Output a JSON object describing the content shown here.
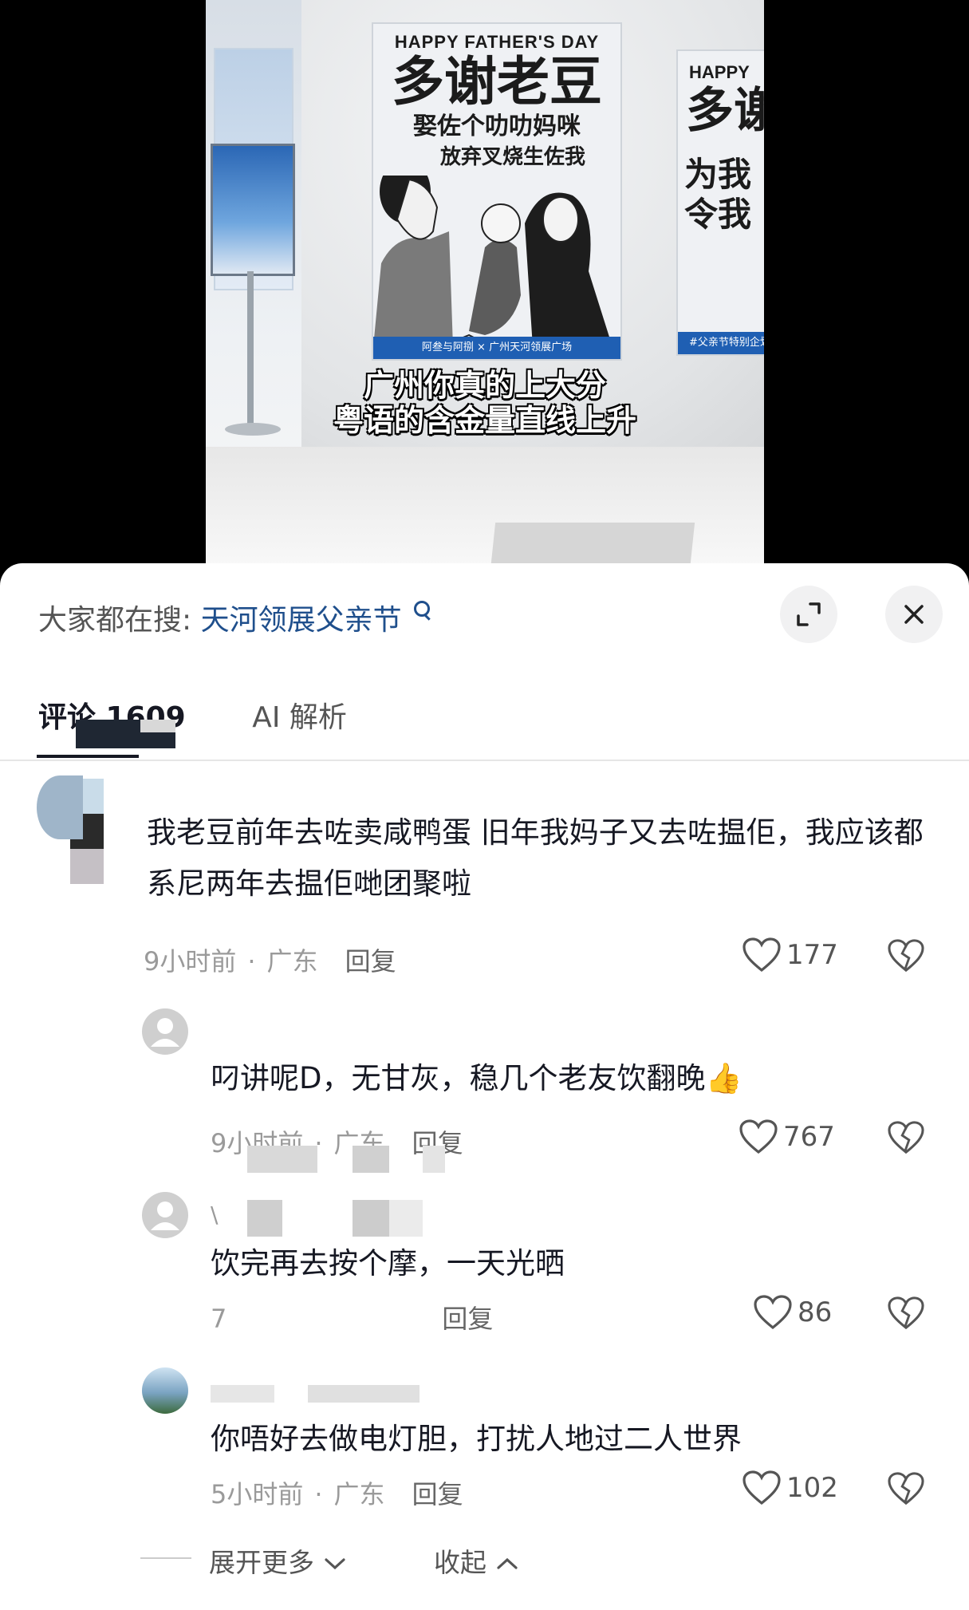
{
  "video": {
    "poster_main": {
      "header": "HAPPY FATHER'S DAY",
      "title": "多谢老豆",
      "line1": "娶佐个叻叻妈咪",
      "line2": "放弃叉烧生佐我",
      "footer": "阿叁与阿捌 × 广州天河领展广场"
    },
    "poster_side": {
      "header": "HAPPY",
      "title": "多谢",
      "line1": "为我",
      "line2": "令我",
      "footer": "#父亲节特别企划"
    },
    "caption_line1": "广州你真的上大分",
    "caption_line2": "粤语的含金量直线上升"
  },
  "search": {
    "prefix": "大家都在搜:",
    "term": "天河领展父亲节"
  },
  "tabs": [
    {
      "label": "评论 1609",
      "active": true
    },
    {
      "label": "AI 解析",
      "active": false
    }
  ],
  "comments": [
    {
      "username": "",
      "text": "我老豆前年去咗卖咸鸭蛋 旧年我妈子又去咗揾佢，我应该都系尼两年去揾佢哋团聚啦",
      "time": "9小时前",
      "location": "广东",
      "reply_label": "回复",
      "likes": "177"
    },
    {
      "username": "",
      "text": "叼讲呢D，无甘灰，稳几个老友饮翻晚",
      "emoji": "👍",
      "time": "9小时前",
      "location": "广东",
      "reply_label": "回复",
      "likes": "767"
    },
    {
      "username": "\\",
      "text": "饮完再去按个摩，一天光晒",
      "time": "7",
      "location": "",
      "reply_label": "回复",
      "likes": "86"
    },
    {
      "username": "",
      "text": "你唔好去做电灯胆，打扰人地过二人世界",
      "time": "5小时前",
      "location": "广东",
      "reply_label": "回复",
      "likes": "102"
    }
  ],
  "footer": {
    "expand_more": "展开更多",
    "collapse": "收起"
  },
  "colors": {
    "link": "#1f4f8c",
    "text": "#161823",
    "meta": "#9a9a9a",
    "poster_blue": "#1f5fb3"
  }
}
